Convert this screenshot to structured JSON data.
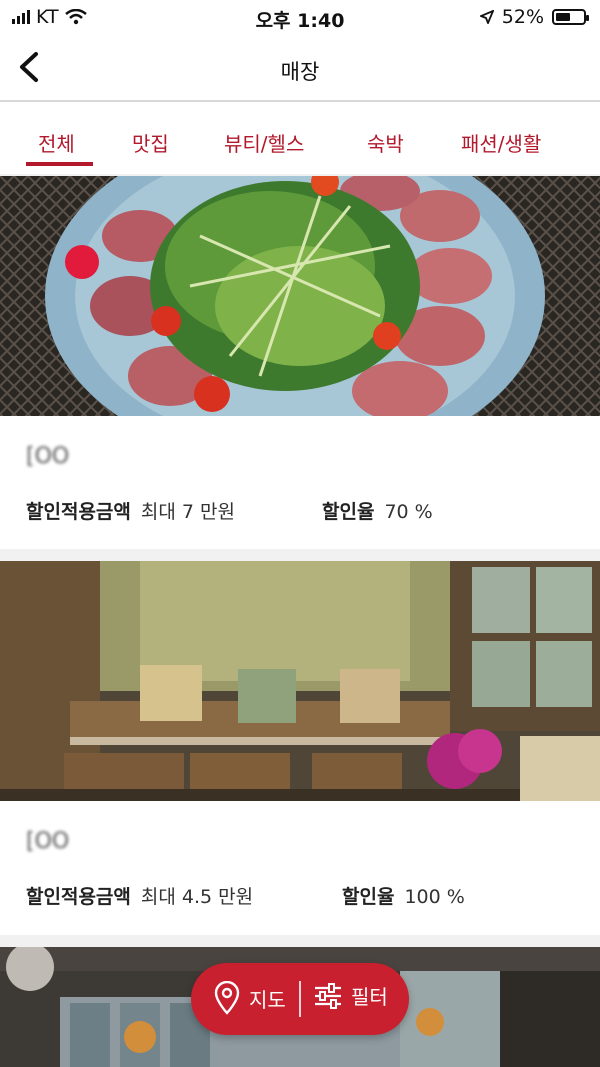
{
  "status": {
    "carrier": "KT",
    "time": "오후 1:40",
    "battery": "52%"
  },
  "nav": {
    "title": "매장"
  },
  "tabs": [
    "전체",
    "맛집",
    "뷰티/헬스",
    "숙박",
    "패션/생활"
  ],
  "stores": [
    {
      "name": "[OO",
      "discount_label": "할인적용금액",
      "discount_value": "최대 7 만원",
      "rate_label": "할인율",
      "rate_value": "70 %"
    },
    {
      "name": "[OO",
      "discount_label": "할인적용금액",
      "discount_value": "최대 4.5 만원",
      "rate_label": "할인율",
      "rate_value": "100 %"
    }
  ],
  "fab": {
    "map_label": "지도",
    "filter_label": "필터"
  },
  "colors": {
    "accent": "#b3192d",
    "fab": "#c8202f"
  }
}
